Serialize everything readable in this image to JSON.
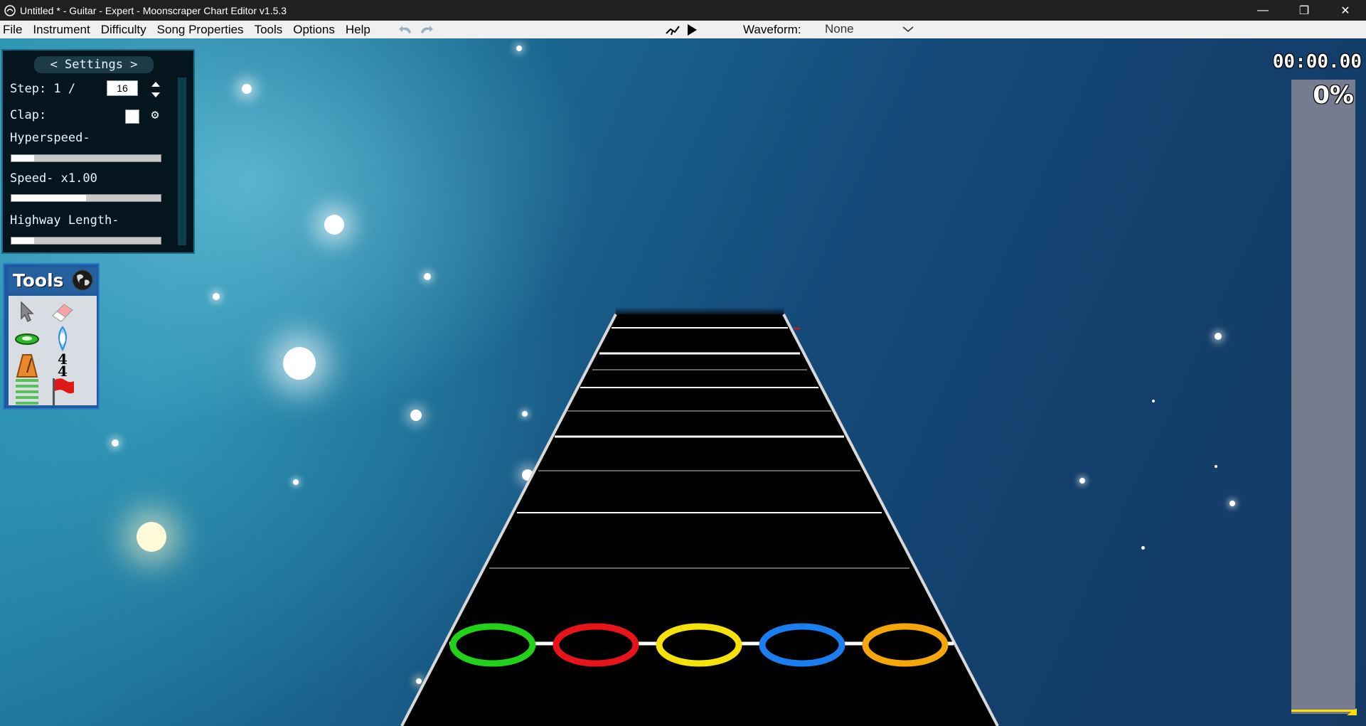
{
  "window": {
    "title": "Untitled * - Guitar - Expert - Moonscraper Chart Editor v1.5.3",
    "minimize": "—",
    "restore": "❐",
    "close": "✕"
  },
  "menu": {
    "items": [
      "File",
      "Instrument",
      "Difficulty",
      "Song Properties",
      "Tools",
      "Options",
      "Help"
    ]
  },
  "toolbar": {
    "waveform_label": "Waveform:",
    "waveform_value": "None"
  },
  "settings": {
    "header": "< Settings >",
    "step_label": "Step: 1 /",
    "step_value": "16",
    "clap_label": "Clap:",
    "hyperspeed_label": "Hyperspeed-",
    "hyperspeed_level": 0.15,
    "speed_label": "Speed- x1.00",
    "speed_level": 0.5,
    "highway_label": "Highway Length-",
    "highway_level": 0.15
  },
  "tools": {
    "title": "Tools",
    "time_signature_top": "4",
    "time_signature_bottom": "4"
  },
  "playback": {
    "time": "00:00.00",
    "progress_label": "0%",
    "progress_fraction": 0.0
  },
  "frets": {
    "colors": [
      "#22d11a",
      "#e8141c",
      "#f5e20a",
      "#1a7ef0",
      "#f5a70a"
    ]
  }
}
